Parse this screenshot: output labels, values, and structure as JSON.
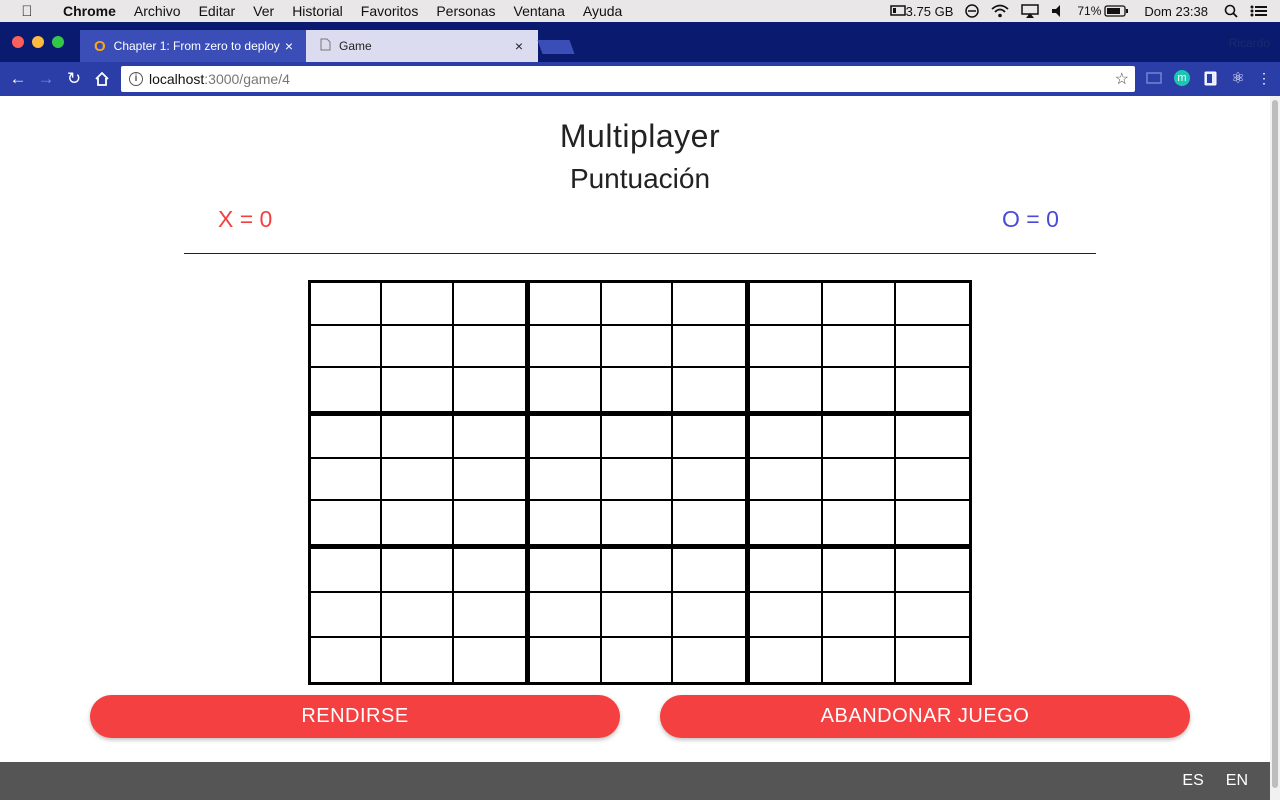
{
  "menubar": {
    "app": "Chrome",
    "items": [
      "Archivo",
      "Editar",
      "Ver",
      "Historial",
      "Favoritos",
      "Personas",
      "Ventana",
      "Ayuda"
    ],
    "memory": "3.75 GB",
    "battery": "71%",
    "clock": "Dom 23:38"
  },
  "browser": {
    "tabs": [
      {
        "title": "Chapter 1: From zero to deploy"
      },
      {
        "title": "Game"
      }
    ],
    "profile": "Ricardo",
    "address": {
      "host": "localhost",
      "path": ":3000/game/4"
    }
  },
  "page": {
    "title": "Multiplayer",
    "subtitle": "Puntuación",
    "score_x": "X = 0",
    "score_o": "O = 0",
    "colors": {
      "x": "#f44040",
      "o": "#4a4ad8",
      "button": "#f44040"
    },
    "board": {
      "rows": 3,
      "cols": 3,
      "sub_rows": 3,
      "sub_cols": 3,
      "cells": []
    },
    "buttons": {
      "surrender": "RENDIRSE",
      "abandon": "ABANDONAR JUEGO"
    }
  },
  "footer": {
    "languages": [
      "ES",
      "EN"
    ]
  }
}
